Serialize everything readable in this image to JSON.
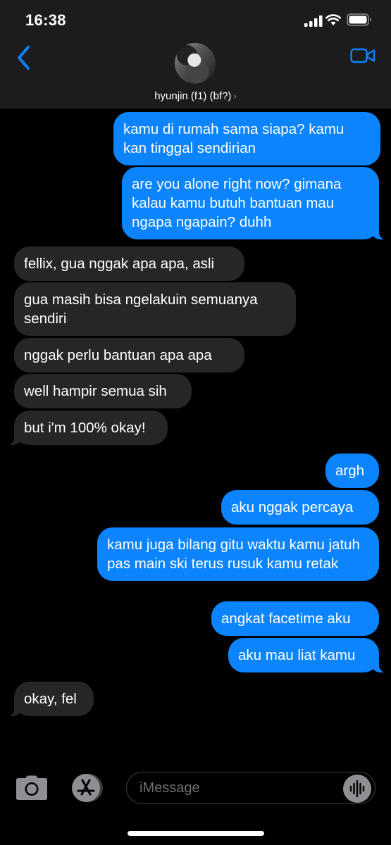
{
  "status": {
    "time": "16:38"
  },
  "contact": {
    "name": "hyunjin (f1) (bf?)",
    "chevron": "›"
  },
  "icons": {
    "back": "chevron-left-icon",
    "video": "video-camera-icon",
    "camera": "camera-icon",
    "apps": "app-store-icon",
    "audio": "audio-waveform-icon"
  },
  "colors": {
    "accent": "#0b84fe",
    "incoming": "#262628",
    "header": "#1c1c1e"
  },
  "messages": [
    {
      "dir": "out",
      "text": "kamu di rumah sama siapa? kamu kan tinggal sendirian"
    },
    {
      "dir": "out",
      "text": "are you alone right now? gimana kalau kamu butuh bantuan mau ngapa ngapain? duhh"
    },
    {
      "dir": "in",
      "text": "fellix, gua nggak apa apa, asli"
    },
    {
      "dir": "in",
      "text": "gua masih bisa ngelakuin semuanya sendiri"
    },
    {
      "dir": "in",
      "text": "nggak perlu bantuan apa apa"
    },
    {
      "dir": "in",
      "text": "well hampir semua sih"
    },
    {
      "dir": "in",
      "text": "but i'm 100% okay!"
    },
    {
      "dir": "out",
      "text": "argh"
    },
    {
      "dir": "out",
      "text": "aku nggak percaya"
    },
    {
      "dir": "out",
      "text": "kamu juga bilang gitu waktu kamu jatuh pas main ski terus rusuk kamu retak"
    },
    {
      "dir": "out",
      "text": "angkat facetime aku"
    },
    {
      "dir": "out",
      "text": "aku mau liat kamu"
    },
    {
      "dir": "in",
      "text": "okay, fel"
    }
  ],
  "composer": {
    "placeholder": "iMessage",
    "value": ""
  }
}
